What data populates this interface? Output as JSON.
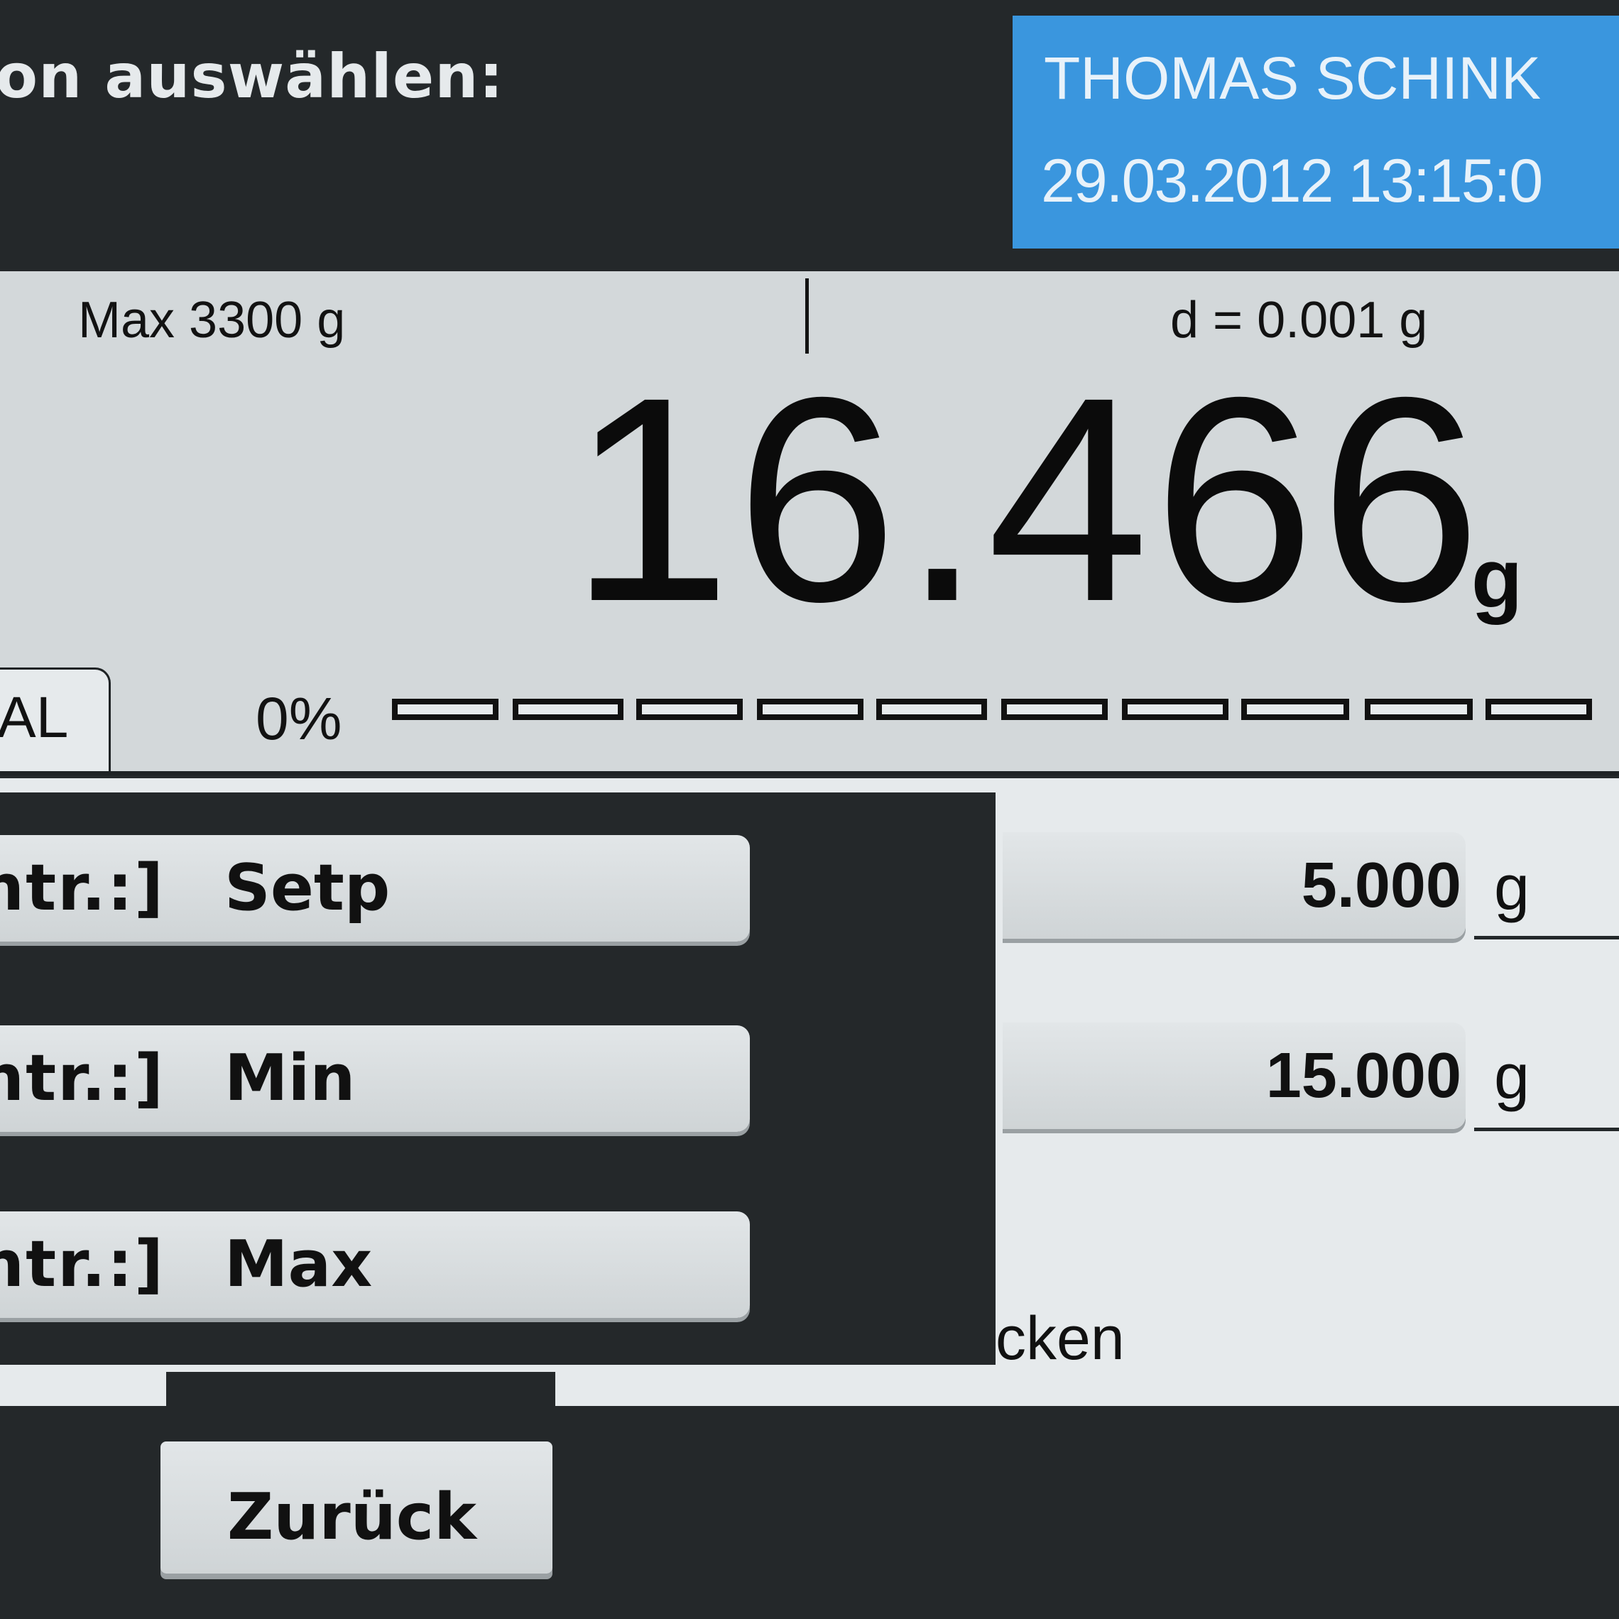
{
  "header": {
    "prompt": "on auswählen:",
    "user_name": "THOMAS SCHINK",
    "datetime": "29.03.2012 13:15:0"
  },
  "display": {
    "max_capacity": "Max 3300 g",
    "readability": "d = 0.001 g",
    "weight_value": "16.466",
    "weight_unit": "g",
    "tab_label": "AL",
    "progress_percent": "0%",
    "progress_fraction": 0
  },
  "menu": {
    "items": [
      {
        "prefix": "ntr.:]",
        "label": "Setp"
      },
      {
        "prefix": "ntr.:]",
        "label": "Min"
      },
      {
        "prefix": "ntr.:]",
        "label": "Max"
      }
    ]
  },
  "fields": [
    {
      "value": "5.000",
      "unit": "g"
    },
    {
      "value": "15.000",
      "unit": "g"
    }
  ],
  "partial_label": "cken",
  "footer": {
    "back_label": "Zurück"
  },
  "colors": {
    "user_panel": "#3a96de",
    "background_dark": "#24282a",
    "display_bg": "#d3d8da"
  }
}
